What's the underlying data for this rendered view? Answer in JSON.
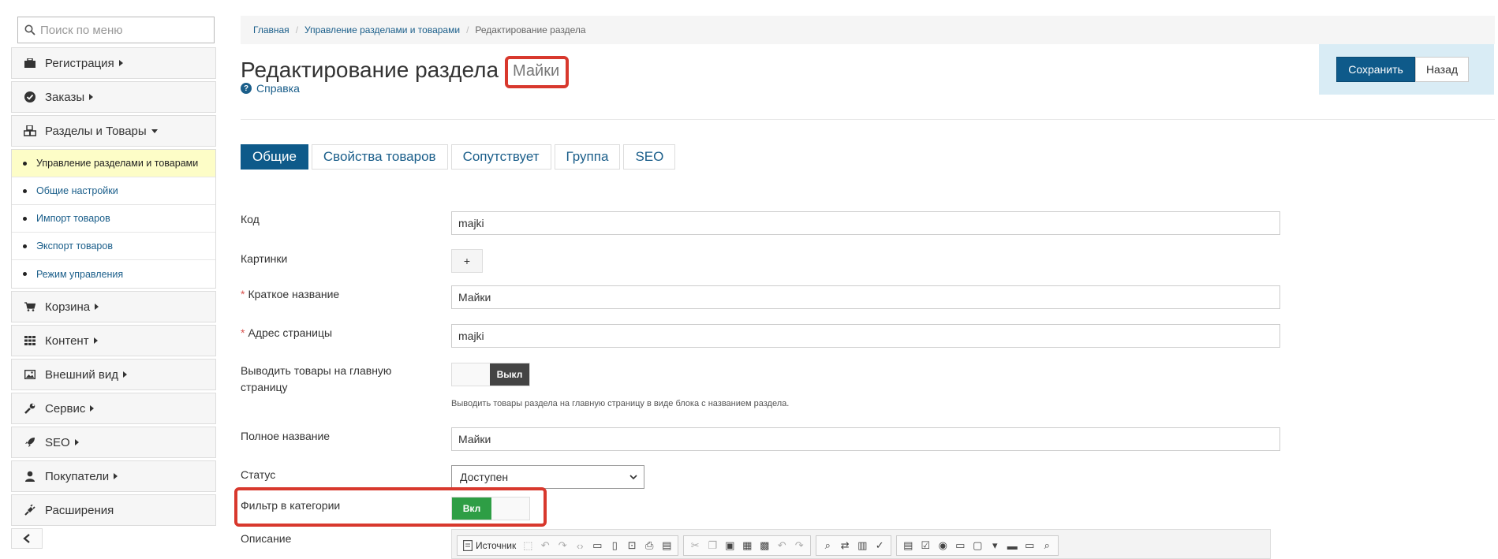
{
  "sidebar": {
    "search_placeholder": "Поиск по меню",
    "items": [
      {
        "label": "Регистрация",
        "icon": "briefcase-icon"
      },
      {
        "label": "Заказы",
        "icon": "check-circle-icon"
      },
      {
        "label": "Разделы и Товары",
        "icon": "cubes-icon",
        "expanded": true
      }
    ],
    "submenu": [
      {
        "label": "Управление разделами и товарами",
        "active": true
      },
      {
        "label": "Общие настройки"
      },
      {
        "label": "Импорт товаров"
      },
      {
        "label": "Экспорт товаров"
      },
      {
        "label": "Режим управления"
      }
    ],
    "items_after": [
      {
        "label": "Корзина",
        "icon": "cart-icon"
      },
      {
        "label": "Контент",
        "icon": "grid-icon"
      },
      {
        "label": "Внешний вид",
        "icon": "image-icon"
      },
      {
        "label": "Сервис",
        "icon": "wrench-icon"
      },
      {
        "label": "SEO",
        "icon": "rocket-icon"
      },
      {
        "label": "Покупатели",
        "icon": "user-icon"
      },
      {
        "label": "Расширения",
        "icon": "plug-icon"
      }
    ]
  },
  "breadcrumb": {
    "home": "Главная",
    "section": "Управление разделами и товарами",
    "current": "Редактирование раздела"
  },
  "page": {
    "title": "Редактирование раздела",
    "title_badge": "Майки",
    "help": "Справка"
  },
  "actions": {
    "save": "Сохранить",
    "back": "Назад"
  },
  "tabs": [
    "Общие",
    "Свойства товаров",
    "Сопутствует",
    "Группа",
    "SEO"
  ],
  "form": {
    "code_label": "Код",
    "code_value": "majki",
    "images_label": "Картинки",
    "images_add": "+",
    "short_name_label": "Краткое название",
    "short_name_value": "Майки",
    "url_label": "Адрес страницы",
    "url_value": "majki",
    "show_main_label": "Выводить товары на главную страницу",
    "show_main_state": "Выкл",
    "show_main_hint": "Выводить товары раздела на главную страницу в виде блока с названием раздела.",
    "full_name_label": "Полное название",
    "full_name_value": "Майки",
    "status_label": "Статус",
    "status_value": "Доступен",
    "filter_label": "Фильтр в категории",
    "filter_state": "Вкл",
    "description_label": "Описание",
    "editor_source": "Источник"
  },
  "colors": {
    "primary": "#0e5a8a",
    "link": "#1a5e8a",
    "success": "#2e9e45",
    "highlight": "#d8382d",
    "active_sub": "#fdfdc7"
  }
}
